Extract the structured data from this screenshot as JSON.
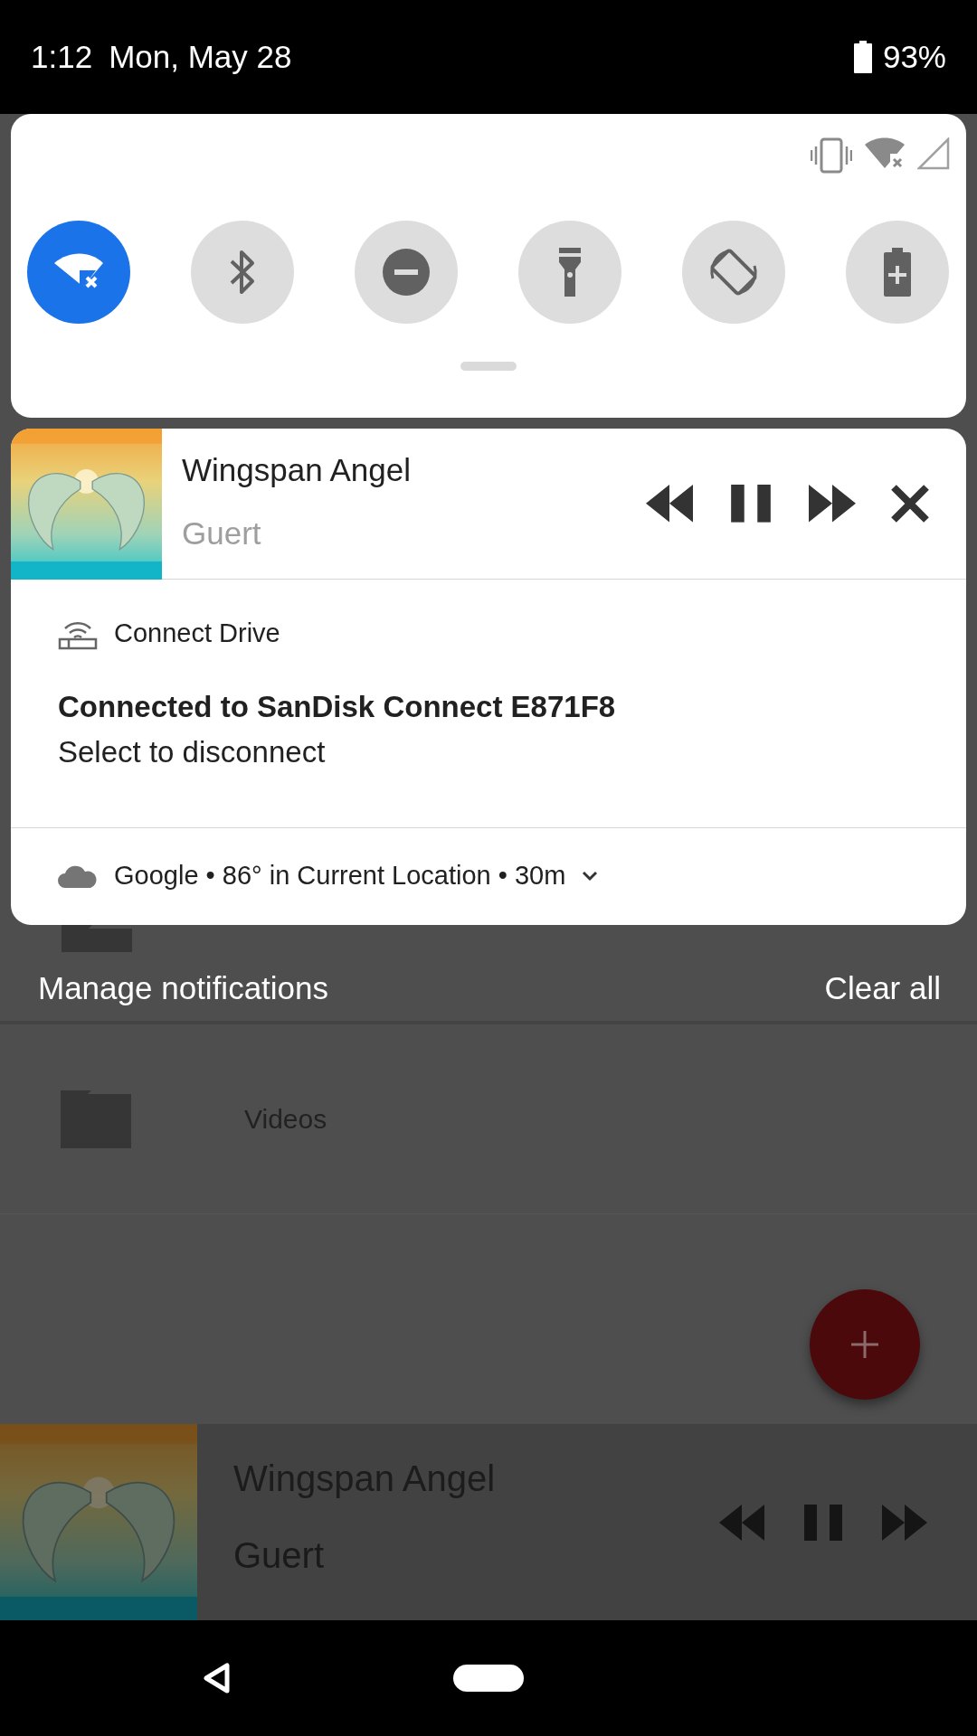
{
  "status_bar": {
    "time": "1:12",
    "date": "Mon, May 28",
    "battery": "93%"
  },
  "quick_settings": {
    "tiles": [
      {
        "kind": "wifi",
        "on": true
      },
      {
        "kind": "bluetooth",
        "on": false
      },
      {
        "kind": "dnd",
        "on": false
      },
      {
        "kind": "flashlight",
        "on": false
      },
      {
        "kind": "rotate",
        "on": false
      },
      {
        "kind": "battery_saver",
        "on": false
      }
    ]
  },
  "media_notification": {
    "title": "Wingspan Angel",
    "artist": "Guert"
  },
  "notifications": [
    {
      "kind": "connect",
      "app": "Connect Drive",
      "title": "Connected to SanDisk Connect E871F8",
      "text": "Select to disconnect"
    },
    {
      "kind": "weather",
      "summary": "Google • 86° in Current Location • 30m"
    }
  ],
  "footer": {
    "manage": "Manage notifications",
    "clear": "Clear all"
  },
  "background_app": {
    "rows": [
      {
        "label": "Videos"
      }
    ],
    "mini_player": {
      "title": "Wingspan Angel",
      "artist": "Guert"
    }
  }
}
